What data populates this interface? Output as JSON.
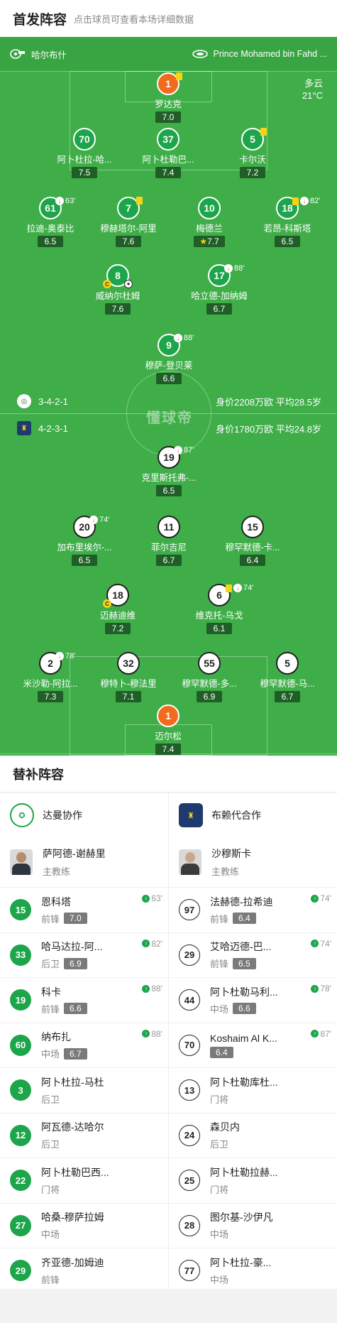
{
  "header": {
    "title": "首发阵容",
    "hint": "点击球员可查看本场详细数据"
  },
  "match": {
    "home_team": "哈尔布什",
    "venue": "Prince Mohamed bin Fahd ...",
    "weather": "多云",
    "temperature": "21°C",
    "center_logo": "懂球帝"
  },
  "formations": {
    "home": {
      "shape": "3-4-2-1",
      "value": "身价2208万欧 平均28.5岁"
    },
    "away": {
      "shape": "4-2-3-1",
      "value": "身价1780万欧 平均24.8岁"
    }
  },
  "home_players": [
    {
      "num": "1",
      "name": "罗达克",
      "rating": "7.0",
      "gk": true,
      "card": true
    },
    {
      "num": "70",
      "name": "阿卜杜拉-哈...",
      "rating": "7.5"
    },
    {
      "num": "37",
      "name": "阿卜杜勒巴...",
      "rating": "7.4"
    },
    {
      "num": "5",
      "name": "卡尔沃",
      "rating": "7.2",
      "card": true
    },
    {
      "num": "61",
      "name": "拉迪-奥泰比",
      "rating": "6.5",
      "sub": "63'"
    },
    {
      "num": "7",
      "name": "穆赫塔尔-阿里",
      "rating": "7.6",
      "card": true
    },
    {
      "num": "10",
      "name": "梅德兰",
      "rating": "7.7",
      "star": true
    },
    {
      "num": "18",
      "name": "若昂-科斯塔",
      "rating": "6.5",
      "card": true,
      "sub": "82'"
    },
    {
      "num": "8",
      "name": "威纳尔杜姆",
      "rating": "7.6",
      "captain": "C",
      "ball": true
    },
    {
      "num": "17",
      "name": "哈立德-加纳姆",
      "rating": "6.7",
      "sub": "88'"
    },
    {
      "num": "9",
      "name": "穆萨-登贝莱",
      "rating": "6.6",
      "sub": "88'"
    }
  ],
  "away_players": [
    {
      "num": "19",
      "name": "克里斯托弗-...",
      "rating": "6.5",
      "sub": "87'"
    },
    {
      "num": "20",
      "name": "加布里埃尔-...",
      "rating": "6.5",
      "sub": "74'"
    },
    {
      "num": "11",
      "name": "菲尔吉尼",
      "rating": "6.7"
    },
    {
      "num": "15",
      "name": "穆罕默德-卡...",
      "rating": "6.4"
    },
    {
      "num": "18",
      "name": "迈赫迪维",
      "rating": "7.2",
      "captain": "C"
    },
    {
      "num": "6",
      "name": "维克托-乌戈",
      "rating": "6.1",
      "card": true,
      "sub": "74'"
    },
    {
      "num": "2",
      "name": "米沙勒-阿拉...",
      "rating": "7.3",
      "sub": "78'"
    },
    {
      "num": "32",
      "name": "穆特卜-穆法里",
      "rating": "7.1"
    },
    {
      "num": "55",
      "name": "穆罕默德-多...",
      "rating": "6.9"
    },
    {
      "num": "5",
      "name": "穆罕默德-马...",
      "rating": "6.7"
    },
    {
      "num": "1",
      "name": "迈尔松",
      "rating": "7.4",
      "gk": true
    }
  ],
  "subs": {
    "title": "替补阵容",
    "home": {
      "club": "达曼协作",
      "coach": {
        "name": "萨阿德-谢赫里",
        "role": "主教练"
      },
      "players": [
        {
          "num": "15",
          "name": "恩科塔",
          "pos": "前锋",
          "rating": "7.0",
          "time": "63'"
        },
        {
          "num": "33",
          "name": "哈马达拉-阿...",
          "pos": "后卫",
          "rating": "6.9",
          "time": "82'"
        },
        {
          "num": "19",
          "name": "科卡",
          "pos": "前锋",
          "rating": "6.6",
          "time": "88'"
        },
        {
          "num": "60",
          "name": "纳布扎",
          "pos": "中场",
          "rating": "6.7",
          "time": "88'"
        },
        {
          "num": "3",
          "name": "阿卜杜拉-马杜",
          "pos": "后卫",
          "rating": "",
          "time": ""
        },
        {
          "num": "12",
          "name": "阿瓦德-达哈尔",
          "pos": "后卫",
          "rating": "",
          "time": ""
        },
        {
          "num": "22",
          "name": "阿卜杜勒巴西...",
          "pos": "门将",
          "rating": "",
          "time": ""
        },
        {
          "num": "27",
          "name": "哈桑-穆萨拉姆",
          "pos": "中场",
          "rating": "",
          "time": ""
        },
        {
          "num": "29",
          "name": "齐亚德-加姆迪",
          "pos": "前锋",
          "rating": "",
          "time": ""
        }
      ]
    },
    "away": {
      "club": "布赖代合作",
      "coach": {
        "name": "沙穆斯卡",
        "role": "主教练"
      },
      "players": [
        {
          "num": "97",
          "name": "法赫德-拉希迪",
          "pos": "前锋",
          "rating": "6.4",
          "time": "74'"
        },
        {
          "num": "29",
          "name": "艾哈迈德-巴...",
          "pos": "前锋",
          "rating": "6.5",
          "time": "74'"
        },
        {
          "num": "44",
          "name": "阿卜杜勒马利...",
          "pos": "中场",
          "rating": "6.6",
          "time": "78'"
        },
        {
          "num": "70",
          "name": "Koshaim Al K...",
          "pos": "",
          "rating": "6.4",
          "time": "87'"
        },
        {
          "num": "13",
          "name": "阿卜杜勒库杜...",
          "pos": "门将",
          "rating": "",
          "time": ""
        },
        {
          "num": "24",
          "name": "森贝内",
          "pos": "后卫",
          "rating": "",
          "time": ""
        },
        {
          "num": "25",
          "name": "阿卜杜勒拉赫...",
          "pos": "门将",
          "rating": "",
          "time": ""
        },
        {
          "num": "28",
          "name": "图尔基-沙伊凡",
          "pos": "中场",
          "rating": "",
          "time": ""
        },
        {
          "num": "77",
          "name": "阿卜杜拉-豪...",
          "pos": "中场",
          "rating": "",
          "time": ""
        }
      ]
    }
  },
  "colors": {
    "pitch": "#3fae49",
    "home": "#1ca54a",
    "goalkeeper": "#f26b1d",
    "card": "#f8d214"
  }
}
